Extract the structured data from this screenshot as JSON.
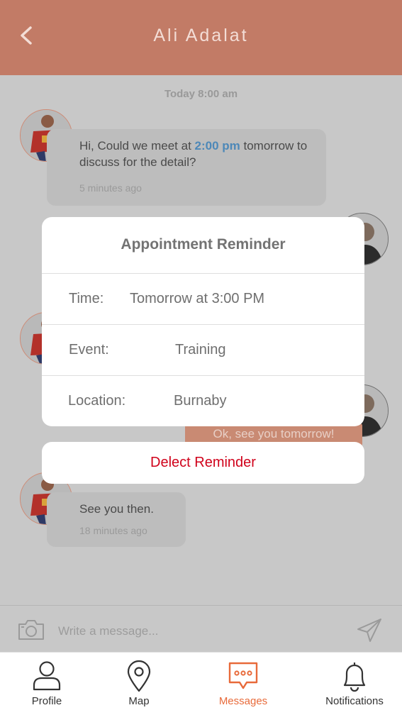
{
  "header": {
    "title": "Ali Adalat",
    "back_icon": "chevron-left-icon"
  },
  "chat": {
    "day_stamp": "Today 8:00 am",
    "messages": [
      {
        "text_before": "Hi,  Could we meet at ",
        "highlight": "2:00 pm",
        "text_after": " tomorrow to discuss for the detail?",
        "time": "5 minutes ago"
      },
      {
        "text": "Ok, see you tomorrow!"
      },
      {
        "text": "See you then.",
        "time": "18 minutes ago"
      }
    ]
  },
  "modal": {
    "title": "Appointment Reminder",
    "rows": [
      {
        "label": "Time:",
        "value": "Tomorrow at 3:00 PM"
      },
      {
        "label": "Event:",
        "value": "Training"
      },
      {
        "label": "Location:",
        "value": "Burnaby"
      }
    ],
    "delete_label": "Delect Reminder"
  },
  "composer": {
    "placeholder": "Write a message...",
    "camera_icon": "camera-icon",
    "send_icon": "send-icon"
  },
  "tabs": [
    {
      "label": "Profile",
      "icon": "person-icon"
    },
    {
      "label": "Map",
      "icon": "map-pin-icon"
    },
    {
      "label": "Messages",
      "icon": "chat-bubble-icon",
      "active": true
    },
    {
      "label": "Notifications",
      "icon": "bell-icon"
    }
  ],
  "colors": {
    "header": "#c27b66",
    "accent": "#e86a3a",
    "danger": "#d0021b",
    "link": "#4d88b8"
  }
}
